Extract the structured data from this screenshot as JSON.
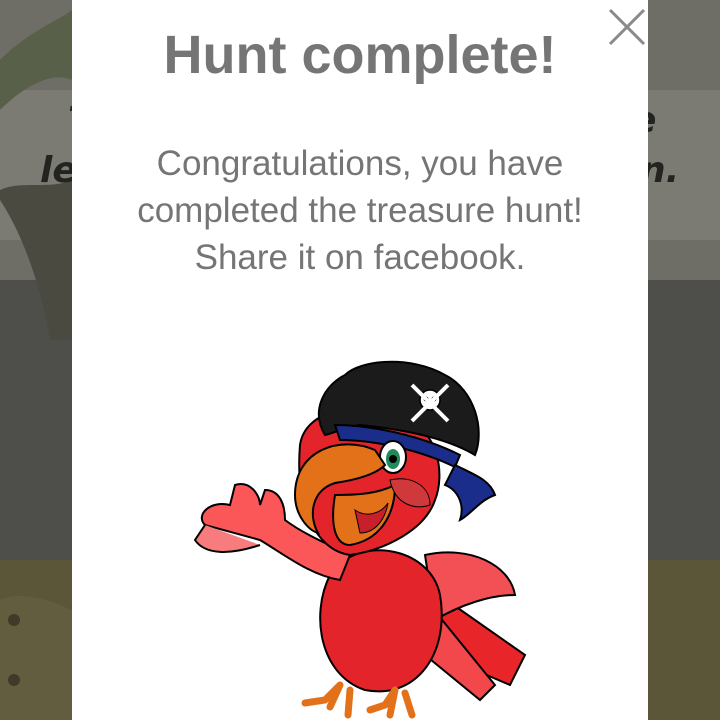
{
  "background": {
    "partial_text": {
      "top_left": "T",
      "top_right": "e",
      "left": "le",
      "right": "n."
    }
  },
  "dialog": {
    "title": "Hunt complete!",
    "message": "Congratulations, you have completed the treasure hunt! Share it on facebook.",
    "close_icon": "close-icon",
    "illustration": "pirate-parrot-illustration"
  },
  "colors": {
    "dialog_bg": "#ffffff",
    "text": "#757575",
    "overlay": "#5a5a52"
  }
}
